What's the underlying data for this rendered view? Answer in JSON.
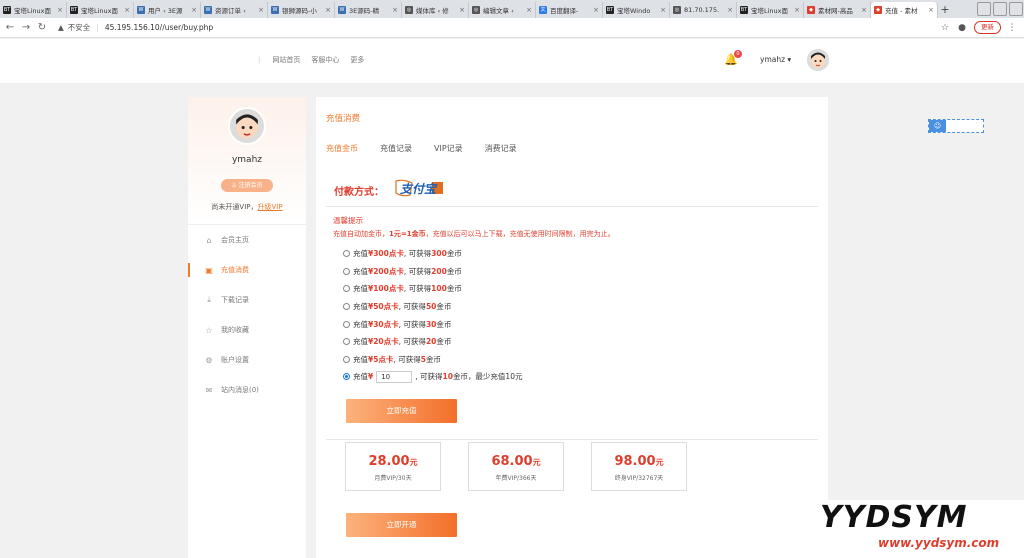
{
  "browser": {
    "tabs": [
      {
        "label": "宝塔Linux面",
        "favicon": "BT",
        "color": "#222222"
      },
      {
        "label": "宝塔Linux面",
        "favicon": "BT",
        "color": "#222222"
      },
      {
        "label": "用户 ‹ 3E源",
        "favicon": "W",
        "color": "#3a6fb0"
      },
      {
        "label": "资源订单 ‹",
        "favicon": "W",
        "color": "#3a6fb0"
      },
      {
        "label": "银狮源码-小",
        "favicon": "W",
        "color": "#3a6fb0"
      },
      {
        "label": "3E源码-精",
        "favicon": "W",
        "color": "#3a6fb0"
      },
      {
        "label": "媒体库 ‹ 修",
        "favicon": "◎",
        "color": "#555555"
      },
      {
        "label": "编辑文章 ‹",
        "favicon": "◎",
        "color": "#555555"
      },
      {
        "label": "百度翻译-",
        "favicon": "文",
        "color": "#2b7de9"
      },
      {
        "label": "宝塔Windo",
        "favicon": "BT",
        "color": "#222222"
      },
      {
        "label": "81.70.175.",
        "favicon": "◎",
        "color": "#555555"
      },
      {
        "label": "宝塔Linux面",
        "favicon": "BT",
        "color": "#222222"
      },
      {
        "label": "素材网-高品",
        "favicon": "◆",
        "color": "#e03e2d"
      },
      {
        "label": "充值 - 素材",
        "favicon": "◆",
        "color": "#e03e2d"
      }
    ],
    "new_tab": "+",
    "insecure_label": "不安全",
    "url": "45.195.156.10//user/buy.php",
    "update_label": "更新"
  },
  "header": {
    "nav": [
      "网站首页",
      "客服中心",
      "更多"
    ],
    "notification_count": "0",
    "username": "ymahz ▾"
  },
  "sidebar": {
    "username": "ymahz",
    "badge": "注册会员",
    "vip_text": "尚未开通VIP，",
    "vip_link": "升级VIP",
    "items": [
      {
        "label": "会员主页",
        "icon": "home-icon",
        "glyph": "⌂"
      },
      {
        "label": "充值消费",
        "icon": "wallet-icon",
        "glyph": "▣"
      },
      {
        "label": "下载记录",
        "icon": "download-icon",
        "glyph": "⤓"
      },
      {
        "label": "我的收藏",
        "icon": "star-icon",
        "glyph": "☆"
      },
      {
        "label": "账户设置",
        "icon": "gear-icon",
        "glyph": "⚙"
      },
      {
        "label": "站内消息(0)",
        "icon": "mail-icon",
        "glyph": "✉"
      }
    ]
  },
  "main": {
    "title": "充值消费",
    "tabs": [
      "充值金币",
      "充值记录",
      "VIP记录",
      "消费记录"
    ],
    "pay_method_label": "付款方式：",
    "alipay_text": "支付宝",
    "hint_title": "温馨提示",
    "hint_prefix": "充值自动加金币，",
    "hint_bold": "1元=1金币",
    "hint_suffix": "，充值以后可以马上下载，充值无使用时间限制，用完为止。",
    "options": [
      {
        "prefix": "充值 ",
        "card": "¥300点卡",
        "mid": ", 可获得 ",
        "coins": "300",
        "suffix": " 金币"
      },
      {
        "prefix": "充值 ",
        "card": "¥200点卡",
        "mid": ", 可获得 ",
        "coins": "200",
        "suffix": " 金币"
      },
      {
        "prefix": "充值 ",
        "card": "¥100点卡",
        "mid": ", 可获得 ",
        "coins": "100",
        "suffix": " 金币"
      },
      {
        "prefix": "充值 ",
        "card": "¥50点卡",
        "mid": ", 可获得 ",
        "coins": "50",
        "suffix": " 金币"
      },
      {
        "prefix": "充值 ",
        "card": "¥30点卡",
        "mid": ", 可获得 ",
        "coins": "30",
        "suffix": " 金币"
      },
      {
        "prefix": "充值 ",
        "card": "¥20点卡",
        "mid": ", 可获得 ",
        "coins": "20",
        "suffix": " 金币"
      },
      {
        "prefix": "充值 ",
        "card": "¥5点卡",
        "mid": ", 可获得 ",
        "coins": "5",
        "suffix": " 金币"
      }
    ],
    "custom": {
      "prefix": "充值 ",
      "currency": "¥",
      "value": "10",
      "mid": " , 可获得 ",
      "coins": "10",
      "suffix": " 金币，最少充值10元"
    },
    "recharge_button": "立即充值",
    "vip_plans": [
      {
        "price": "28.00",
        "unit": "元",
        "desc": "月费VIP/30天"
      },
      {
        "price": "68.00",
        "unit": "元",
        "desc": "年费VIP/366天"
      },
      {
        "price": "98.00",
        "unit": "元",
        "desc": "终身VIP/32767天"
      }
    ],
    "open_button": "立即开通"
  },
  "watermark": {
    "big": "YYDSYM",
    "small": "www.yydsym.com"
  },
  "colors": {
    "accent": "#f07a2c",
    "red": "#e03e2d",
    "link": "#1a73e8"
  }
}
